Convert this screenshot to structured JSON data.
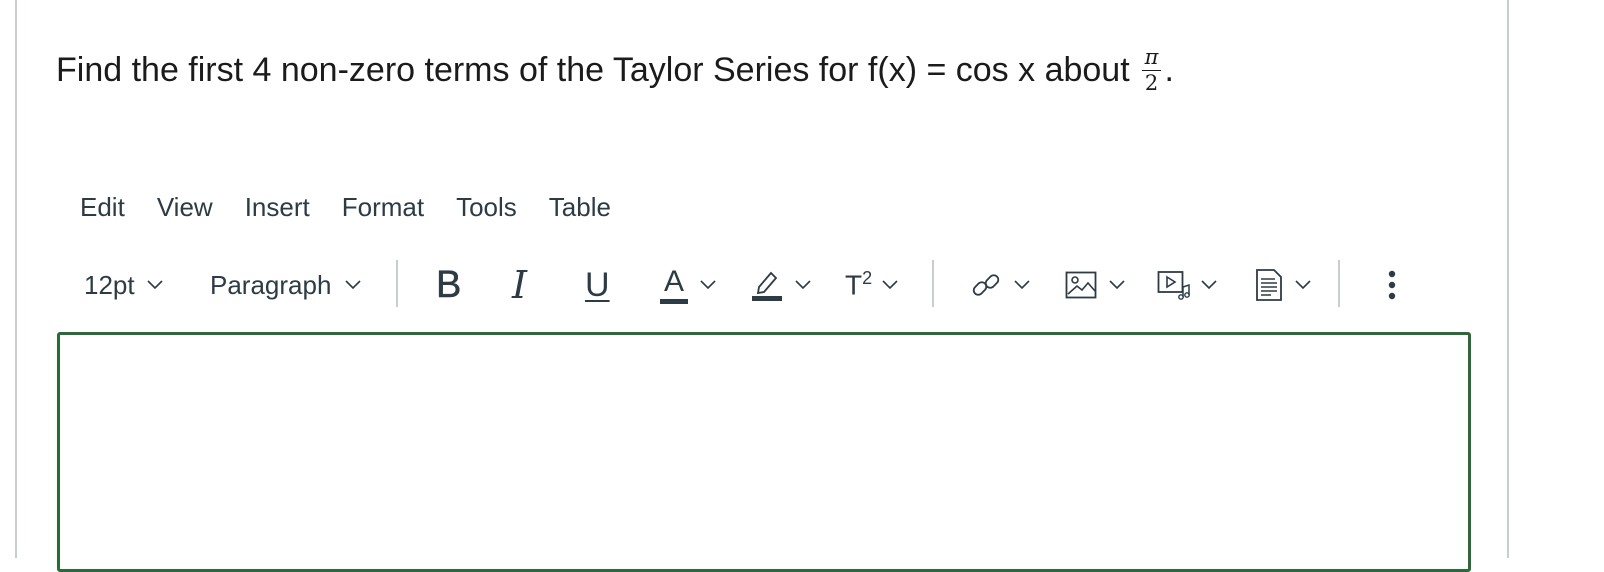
{
  "question": {
    "text": "Find the first 4 non-zero terms of the Taylor Series for f(x) = cos x about",
    "fraction_numerator": "π",
    "fraction_denominator": "2",
    "end_punct": "."
  },
  "menubar": [
    "Edit",
    "View",
    "Insert",
    "Format",
    "Tools",
    "Table"
  ],
  "toolbar": {
    "font_size": "12pt",
    "block_format": "Paragraph",
    "bold": "B",
    "italic": "I",
    "underline": "U",
    "text_color": "A",
    "superscript_base": "T",
    "superscript_exp": "2"
  },
  "icons": [
    "chevron-down-icon",
    "bold-icon",
    "italic-icon",
    "underline-icon",
    "text-color-icon",
    "highlight-icon",
    "superscript-icon",
    "link-icon",
    "image-icon",
    "media-icon",
    "document-icon",
    "more-vertical-icon"
  ],
  "colors": {
    "editor_border": "#2b6a38",
    "text": "#2d3b45",
    "separator": "#c7cdd1"
  },
  "editor": {
    "content": ""
  }
}
